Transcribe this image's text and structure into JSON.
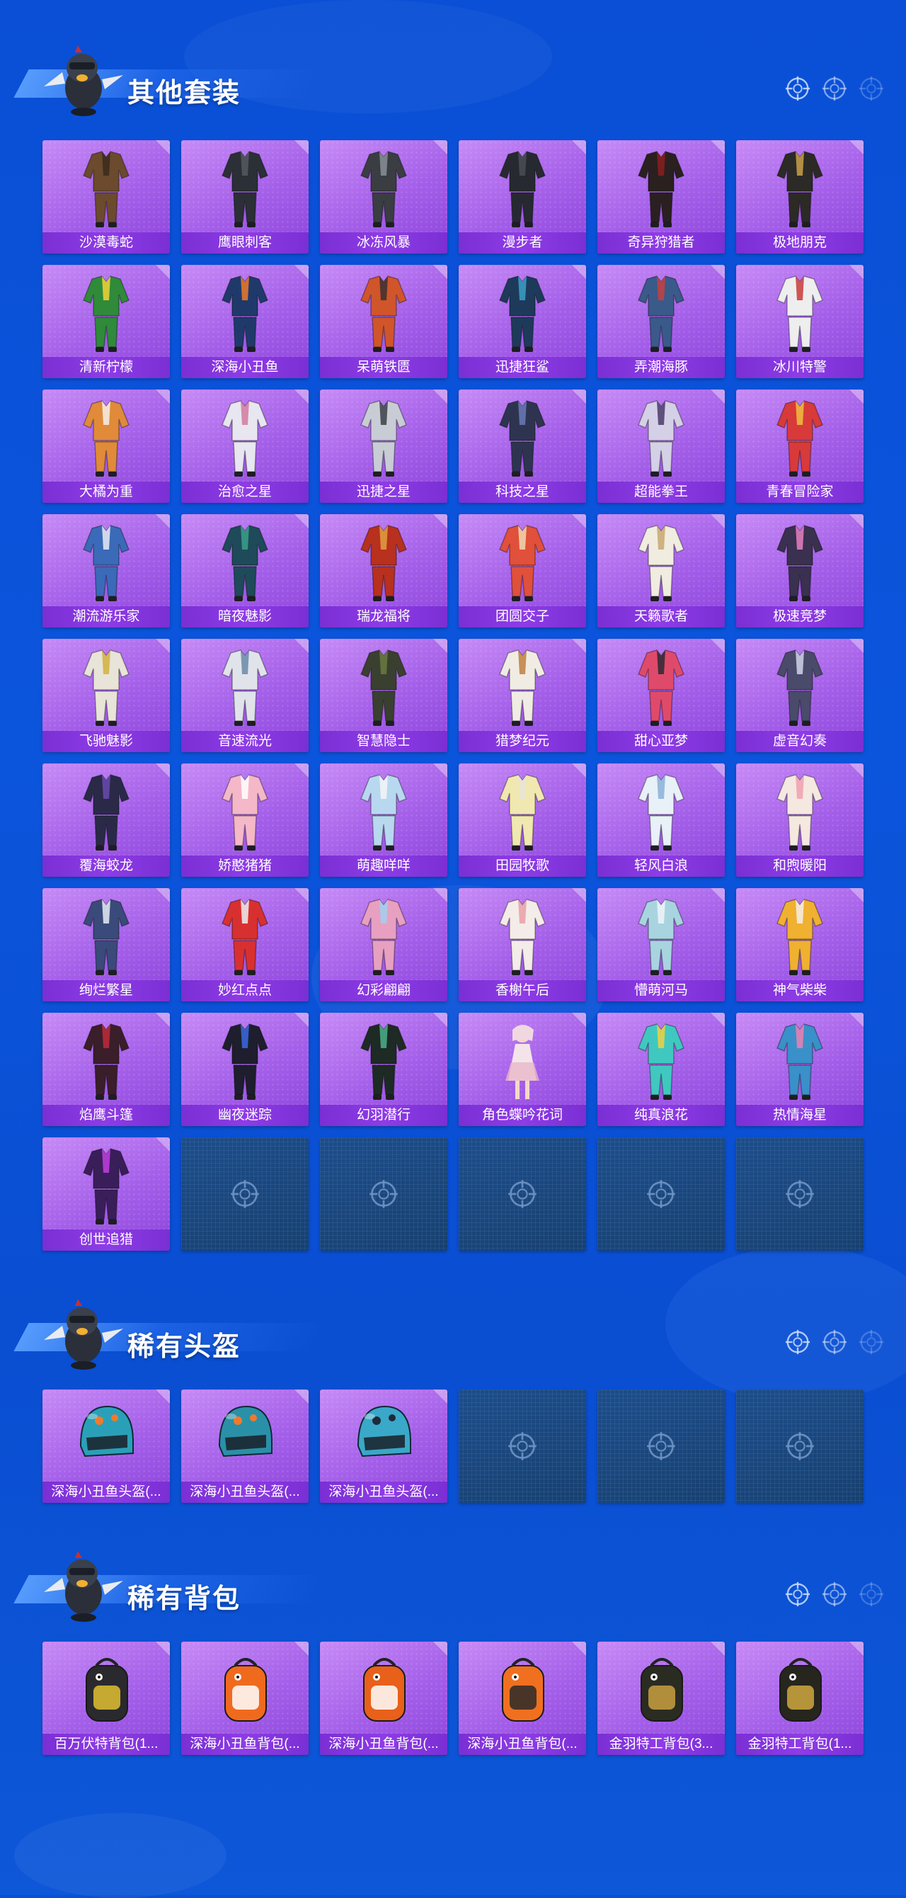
{
  "sections": [
    {
      "title": "其他套装",
      "items": [
        {
          "label": "沙漠毒蛇",
          "kind": "outfit",
          "color": "#6b4a2e",
          "accent": "#3a2a1c"
        },
        {
          "label": "鹰眼刺客",
          "kind": "outfit",
          "color": "#2b2f36",
          "accent": "#55595f"
        },
        {
          "label": "冰冻风暴",
          "kind": "outfit",
          "color": "#3a3d42",
          "accent": "#8a8f96"
        },
        {
          "label": "漫步者",
          "kind": "outfit",
          "color": "#262a30",
          "accent": "#4a4f56"
        },
        {
          "label": "奇异狩猎者",
          "kind": "outfit",
          "color": "#2a2020",
          "accent": "#8b1f1f"
        },
        {
          "label": "极地朋克",
          "kind": "outfit",
          "color": "#2c2a26",
          "accent": "#c9a04a"
        },
        {
          "label": "清新柠檬",
          "kind": "outfit",
          "color": "#2f8a3a",
          "accent": "#f2d23a"
        },
        {
          "label": "深海小丑鱼",
          "kind": "outfit",
          "color": "#1f3a6a",
          "accent": "#f07a2a"
        },
        {
          "label": "呆萌铁匮",
          "kind": "outfit",
          "color": "#d0552a",
          "accent": "#3a3030"
        },
        {
          "label": "迅捷狂鲨",
          "kind": "outfit",
          "color": "#1e3a5a",
          "accent": "#3aa0c8"
        },
        {
          "label": "弄潮海豚",
          "kind": "outfit",
          "color": "#3a5a8a",
          "accent": "#c84040"
        },
        {
          "label": "冰川特警",
          "kind": "outfit",
          "color": "#eeeeee",
          "accent": "#c83a3a"
        },
        {
          "label": "大橘为重",
          "kind": "outfit",
          "color": "#e08a3a",
          "accent": "#f4f0ea"
        },
        {
          "label": "治愈之星",
          "kind": "outfit",
          "color": "#e8e6f0",
          "accent": "#d07aa0"
        },
        {
          "label": "迅捷之星",
          "kind": "outfit",
          "color": "#c8ccd4",
          "accent": "#3a3e48"
        },
        {
          "label": "科技之星",
          "kind": "outfit",
          "color": "#2e3450",
          "accent": "#6a7ab8"
        },
        {
          "label": "超能拳王",
          "kind": "outfit",
          "color": "#d4d0e6",
          "accent": "#4a3a6a"
        },
        {
          "label": "青春冒险家",
          "kind": "outfit",
          "color": "#d83a3a",
          "accent": "#f0c040"
        },
        {
          "label": "潮流游乐家",
          "kind": "outfit",
          "color": "#3a6ab8",
          "accent": "#eaeaf2"
        },
        {
          "label": "暗夜魅影",
          "kind": "outfit",
          "color": "#1e4a5a",
          "accent": "#3aa08a"
        },
        {
          "label": "瑞龙福将",
          "kind": "outfit",
          "color": "#b8301e",
          "accent": "#e0a040"
        },
        {
          "label": "团圆交子",
          "kind": "outfit",
          "color": "#e0503a",
          "accent": "#f0d8b0"
        },
        {
          "label": "天籁歌者",
          "kind": "outfit",
          "color": "#f0ece0",
          "accent": "#c8a870"
        },
        {
          "label": "极速竞梦",
          "kind": "outfit",
          "color": "#3a3050",
          "accent": "#e880c0"
        },
        {
          "label": "飞驰魅影",
          "kind": "outfit",
          "color": "#e8e4d8",
          "accent": "#d4b040"
        },
        {
          "label": "音速流光",
          "kind": "outfit",
          "color": "#e0e4ea",
          "accent": "#6a8aa8"
        },
        {
          "label": "智慧隐士",
          "kind": "outfit",
          "color": "#3a4030",
          "accent": "#6a7a40"
        },
        {
          "label": "猎梦纪元",
          "kind": "outfit",
          "color": "#f0ece4",
          "accent": "#c08040"
        },
        {
          "label": "甜心亚梦",
          "kind": "outfit",
          "color": "#e04a6a",
          "accent": "#2a2a34"
        },
        {
          "label": "虚音幻奏",
          "kind": "outfit",
          "color": "#4a4a6a",
          "accent": "#d0d4e8"
        },
        {
          "label": "覆海蛟龙",
          "kind": "outfit",
          "color": "#2a2a48",
          "accent": "#6a4ab0"
        },
        {
          "label": "娇憨猪猪",
          "kind": "outfit",
          "color": "#f4b8c8",
          "accent": "#ffffff"
        },
        {
          "label": "萌趣咩咩",
          "kind": "outfit",
          "color": "#b8d8f0",
          "accent": "#f4f4f8"
        },
        {
          "label": "田园牧歌",
          "kind": "outfit",
          "color": "#f0e8b0",
          "accent": "#e8e4d8"
        },
        {
          "label": "轻风白浪",
          "kind": "outfit",
          "color": "#e8f0f8",
          "accent": "#8ab0d8"
        },
        {
          "label": "和煦暖阳",
          "kind": "outfit",
          "color": "#f4e8e0",
          "accent": "#f0a0b0"
        },
        {
          "label": "绚烂繁星",
          "kind": "outfit",
          "color": "#3a4a7a",
          "accent": "#e8ecf4"
        },
        {
          "label": "妙红点点",
          "kind": "outfit",
          "color": "#d83030",
          "accent": "#f0f0f0"
        },
        {
          "label": "幻彩翩翩",
          "kind": "outfit",
          "color": "#e8a0c0",
          "accent": "#a0d0f0"
        },
        {
          "label": "香榭午后",
          "kind": "outfit",
          "color": "#f4ece8",
          "accent": "#e8a0a8"
        },
        {
          "label": "懵萌河马",
          "kind": "outfit",
          "color": "#a8d4e0",
          "accent": "#f0f4f8"
        },
        {
          "label": "神气柴柴",
          "kind": "outfit",
          "color": "#f0b030",
          "accent": "#f4f0e8"
        },
        {
          "label": "焰鹰斗篷",
          "kind": "outfit",
          "color": "#3a1e2a",
          "accent": "#c02a3a"
        },
        {
          "label": "幽夜迷踪",
          "kind": "outfit",
          "color": "#1e1e2e",
          "accent": "#3a6ae0"
        },
        {
          "label": "幻羽潜行",
          "kind": "outfit",
          "color": "#1e2a24",
          "accent": "#4ab08a"
        },
        {
          "label": "角色蝶吟花词",
          "kind": "character",
          "color": "#f4e4ea",
          "accent": "#e8b8c8"
        },
        {
          "label": "纯真浪花",
          "kind": "outfit",
          "color": "#40c8c0",
          "accent": "#f0d040"
        },
        {
          "label": "热情海星",
          "kind": "outfit",
          "color": "#3a90c8",
          "accent": "#f080b0"
        },
        {
          "label": "创世追猎",
          "kind": "outfit",
          "color": "#3a1e5a",
          "accent": "#c040e0"
        }
      ],
      "empty_slots": 5
    },
    {
      "title": "稀有头盔",
      "items": [
        {
          "label": "深海小丑鱼头盔(...",
          "kind": "helmet",
          "color": "#2aa0b8",
          "accent": "#f07a2a"
        },
        {
          "label": "深海小丑鱼头盔(...",
          "kind": "helmet",
          "color": "#2a90a8",
          "accent": "#f07a2a"
        },
        {
          "label": "深海小丑鱼头盔(...",
          "kind": "helmet",
          "color": "#3aa8c8",
          "accent": "#1e2a3a"
        }
      ],
      "empty_slots": 3
    },
    {
      "title": "稀有背包",
      "items": [
        {
          "label": "百万伏特背包(1...",
          "kind": "backpack",
          "color": "#2a2a2e",
          "accent": "#e0c030"
        },
        {
          "label": "深海小丑鱼背包(...",
          "kind": "backpack",
          "color": "#f06a1e",
          "accent": "#ffffff"
        },
        {
          "label": "深海小丑鱼背包(...",
          "kind": "backpack",
          "color": "#e8601a",
          "accent": "#ffffff"
        },
        {
          "label": "深海小丑鱼背包(...",
          "kind": "backpack",
          "color": "#f07020",
          "accent": "#2a2a2a"
        },
        {
          "label": "金羽特工背包(3...",
          "kind": "backpack",
          "color": "#2a2c22",
          "accent": "#c8a040"
        },
        {
          "label": "金羽特工背包(1...",
          "kind": "backpack",
          "color": "#26261e",
          "accent": "#d0a840"
        }
      ],
      "empty_slots": 0
    }
  ],
  "icons": {
    "header_decoration": "crosshair-target-icon",
    "empty_slot": "crosshair-target-icon",
    "mascot": "chicken-mascot-icon"
  },
  "colors": {
    "background": "#0a4fd6",
    "card_purple": "#a45fe9",
    "card_label": "#7a2fd4",
    "empty_slot": "#1d4d8a"
  }
}
